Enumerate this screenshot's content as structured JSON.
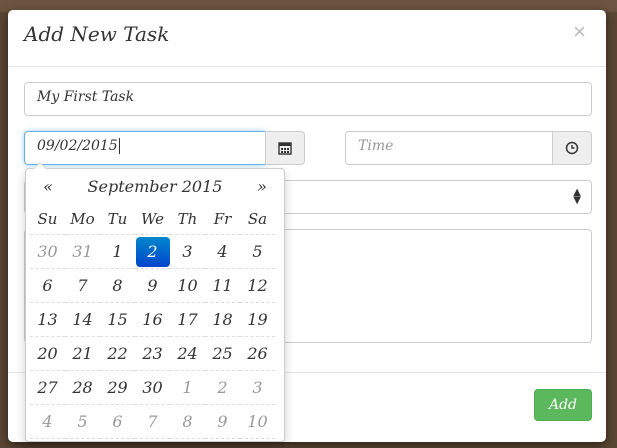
{
  "modal": {
    "title": "Add New Task",
    "close_glyph": "×",
    "task_name_value": "My First Task",
    "date_value": "09/02/2015",
    "time_placeholder": "Time",
    "add_label": "Add"
  },
  "datepicker": {
    "prev": "«",
    "next": "»",
    "month_label": "September 2015",
    "weekdays": [
      "Su",
      "Mo",
      "Tu",
      "We",
      "Th",
      "Fr",
      "Sa"
    ],
    "weeks": [
      [
        {
          "d": "30",
          "m": true
        },
        {
          "d": "31",
          "m": true
        },
        {
          "d": "1"
        },
        {
          "d": "2",
          "a": true
        },
        {
          "d": "3"
        },
        {
          "d": "4"
        },
        {
          "d": "5"
        }
      ],
      [
        {
          "d": "6"
        },
        {
          "d": "7"
        },
        {
          "d": "8"
        },
        {
          "d": "9"
        },
        {
          "d": "10"
        },
        {
          "d": "11"
        },
        {
          "d": "12"
        }
      ],
      [
        {
          "d": "13"
        },
        {
          "d": "14"
        },
        {
          "d": "15"
        },
        {
          "d": "16"
        },
        {
          "d": "17"
        },
        {
          "d": "18"
        },
        {
          "d": "19"
        }
      ],
      [
        {
          "d": "20"
        },
        {
          "d": "21"
        },
        {
          "d": "22"
        },
        {
          "d": "23"
        },
        {
          "d": "24"
        },
        {
          "d": "25"
        },
        {
          "d": "26"
        }
      ],
      [
        {
          "d": "27"
        },
        {
          "d": "28"
        },
        {
          "d": "29"
        },
        {
          "d": "30"
        },
        {
          "d": "1",
          "m": true
        },
        {
          "d": "2",
          "m": true
        },
        {
          "d": "3",
          "m": true
        }
      ],
      [
        {
          "d": "4",
          "m": true
        },
        {
          "d": "5",
          "m": true
        },
        {
          "d": "6",
          "m": true
        },
        {
          "d": "7",
          "m": true
        },
        {
          "d": "8",
          "m": true
        },
        {
          "d": "9",
          "m": true
        },
        {
          "d": "10",
          "m": true
        }
      ]
    ]
  },
  "colors": {
    "primary_active": "#0d6fd0",
    "success": "#5cb85c",
    "focus_border": "#66afe9"
  },
  "icons": {
    "calendar": "calendar-icon",
    "clock": "clock-icon",
    "select": "select-arrows-icon"
  }
}
